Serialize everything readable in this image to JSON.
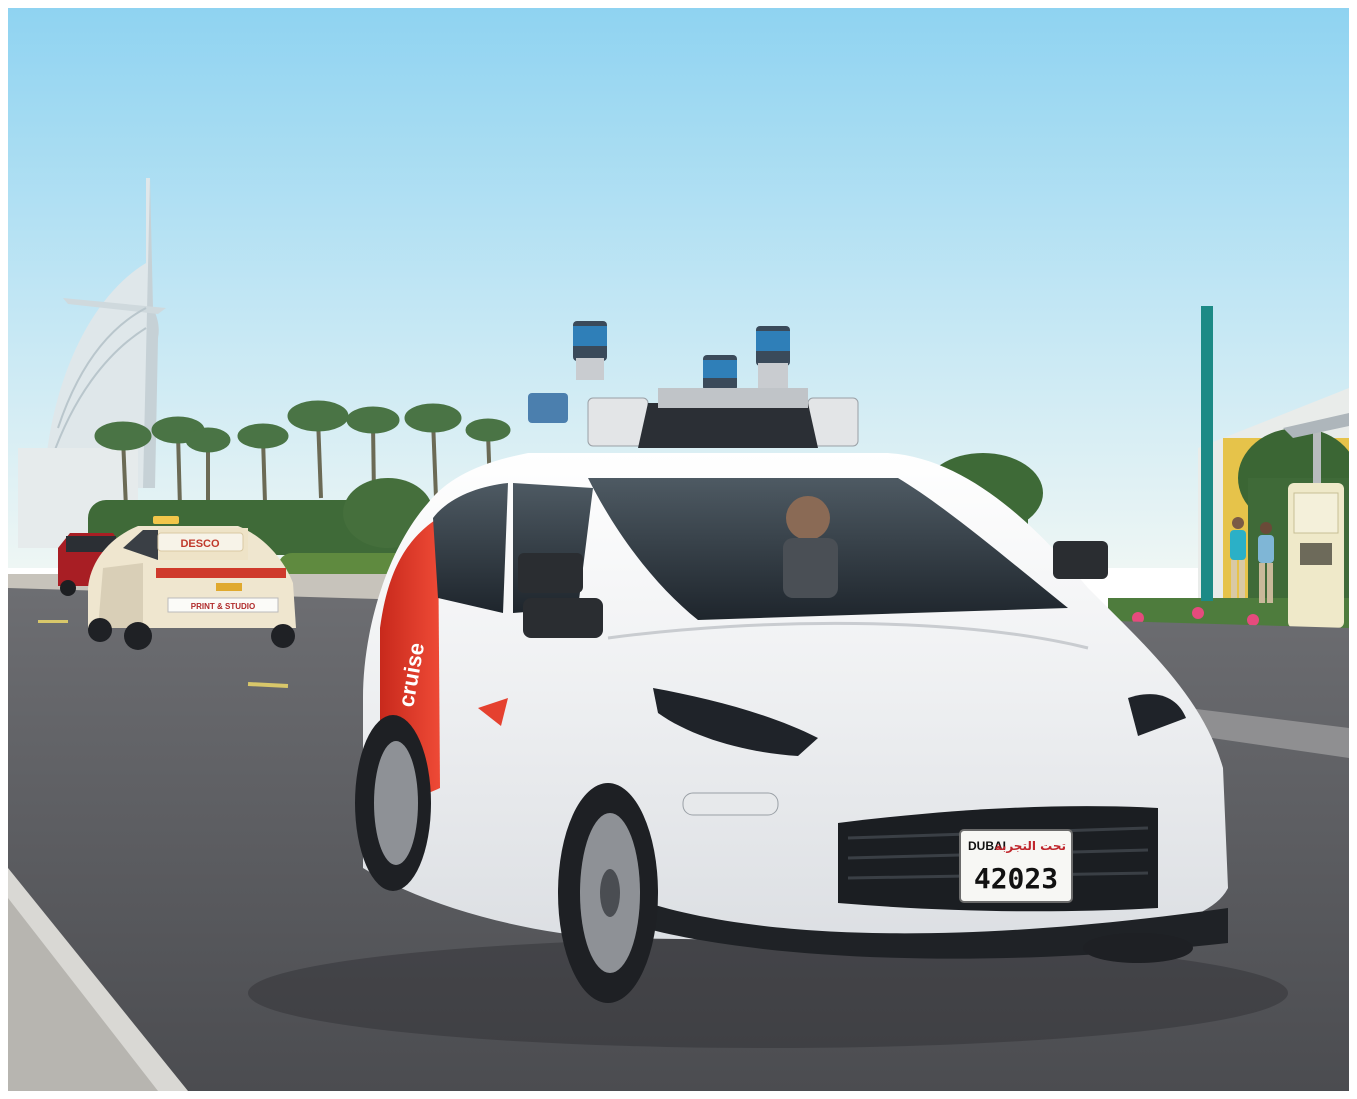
{
  "photo": {
    "colors": {
      "sky_top": "#8fd3f1",
      "sky_bottom": "#e9f4f5",
      "road": "#5a5b5f",
      "car_body": "#f4f5f6",
      "car_accent": "#e5412f",
      "taxi_body": "#efe6cf",
      "palm_green": "#3d6b3a",
      "pole_teal": "#1c8a86"
    },
    "robotaxi": {
      "brand_text": "cruise",
      "plate_city": "DUBAI",
      "plate_arabic": "تحت التجربة",
      "plate_number": "42023"
    },
    "taxi": {
      "roof_sign_text": "DESCO",
      "rear_panel_text": "PRINT & STUDIO"
    }
  }
}
